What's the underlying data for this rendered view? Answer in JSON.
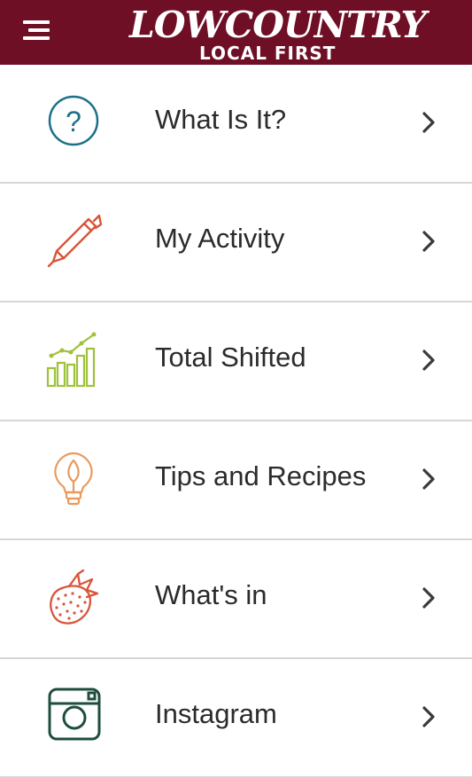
{
  "header": {
    "brand_main": "LOWCOUNTRY",
    "brand_sub": "LOCAL FIRST",
    "menu_icon": "hamburger-menu-icon",
    "background": "#6f0f26"
  },
  "menu": {
    "items": [
      {
        "label": "What Is It?",
        "icon": "question-circle-icon",
        "color": "#1c7089"
      },
      {
        "label": "My Activity",
        "icon": "pen-icon",
        "color": "#d9543a"
      },
      {
        "label": "Total Shifted",
        "icon": "bar-chart-icon",
        "color": "#9ec23a"
      },
      {
        "label": "Tips and Recipes",
        "icon": "lightbulb-icon",
        "color": "#ea9a5c"
      },
      {
        "label": "What's in",
        "icon": "strawberry-icon",
        "color": "#d9543a"
      },
      {
        "label": "Instagram",
        "icon": "instagram-icon",
        "color": "#1f4e3d"
      }
    ],
    "chevron_icon": "chevron-right-icon"
  }
}
